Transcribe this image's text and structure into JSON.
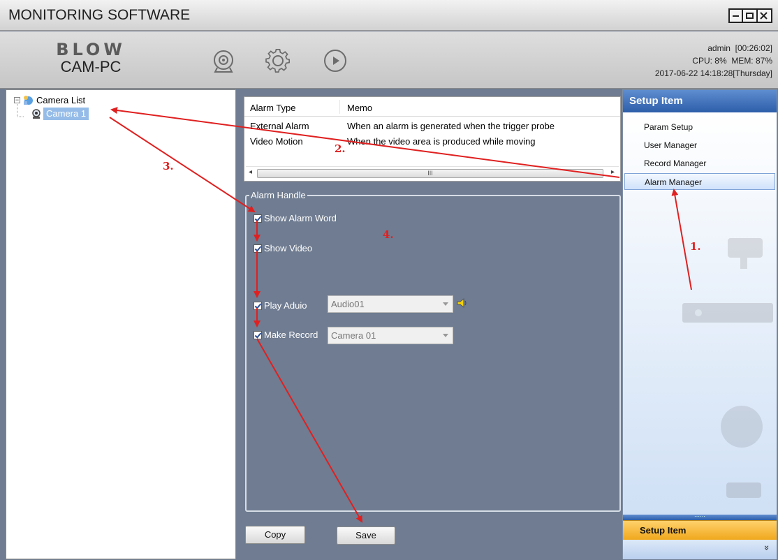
{
  "window": {
    "title": "MONITORING SOFTWARE",
    "controls": [
      "minimize",
      "maximize",
      "close"
    ]
  },
  "toolbar": {
    "brand_logo": "BLOW",
    "brand_name": "CAM-PC",
    "icons": [
      "camera-icon",
      "gear-icon",
      "play-icon"
    ]
  },
  "status": {
    "user": "admin",
    "session_time": "[00:26:02]",
    "cpu": "CPU: 8%",
    "mem": "MEM: 87%",
    "datetime": "2017-06-22 14:18:28[Thursday]"
  },
  "tree": {
    "root_label": "Camera List",
    "camera_label": "Camera 1"
  },
  "alarm_table": {
    "columns": [
      "Alarm Type",
      "Memo"
    ],
    "rows": [
      [
        "External Alarm",
        "When an alarm is generated when the trigger probe"
      ],
      [
        "Video Motion",
        "When the video area is produced while moving"
      ]
    ],
    "scroll_grip": "III"
  },
  "alarm_handle": {
    "legend": "Alarm Handle",
    "show_alarm_word": {
      "label": "Show Alarm Word",
      "checked": true
    },
    "show_video": {
      "label": "Show Video",
      "checked": true
    },
    "play_audio": {
      "label": "Play Aduio",
      "checked": true,
      "selected": "Audio01"
    },
    "make_record": {
      "label": "Make Record",
      "checked": true,
      "selected": "Camera 01"
    }
  },
  "buttons": {
    "copy": "Copy",
    "save": "Save"
  },
  "setup": {
    "header": "Setup Item",
    "items": [
      "Param Setup",
      "User Manager",
      "Record Manager",
      "Alarm Manager"
    ],
    "active_item": "Alarm Manager",
    "footer": "Setup Item",
    "expand_glyph": "»"
  },
  "annotations": {
    "step1": "1.",
    "step2": "2.",
    "step3": "3.",
    "step4": "4.",
    "color": "#e02020"
  },
  "colors": {
    "workspace": "#6f7c91",
    "setup_header": "#2d5ea9",
    "setup_footer": "#f0a81d",
    "selection": "#95bce8"
  }
}
